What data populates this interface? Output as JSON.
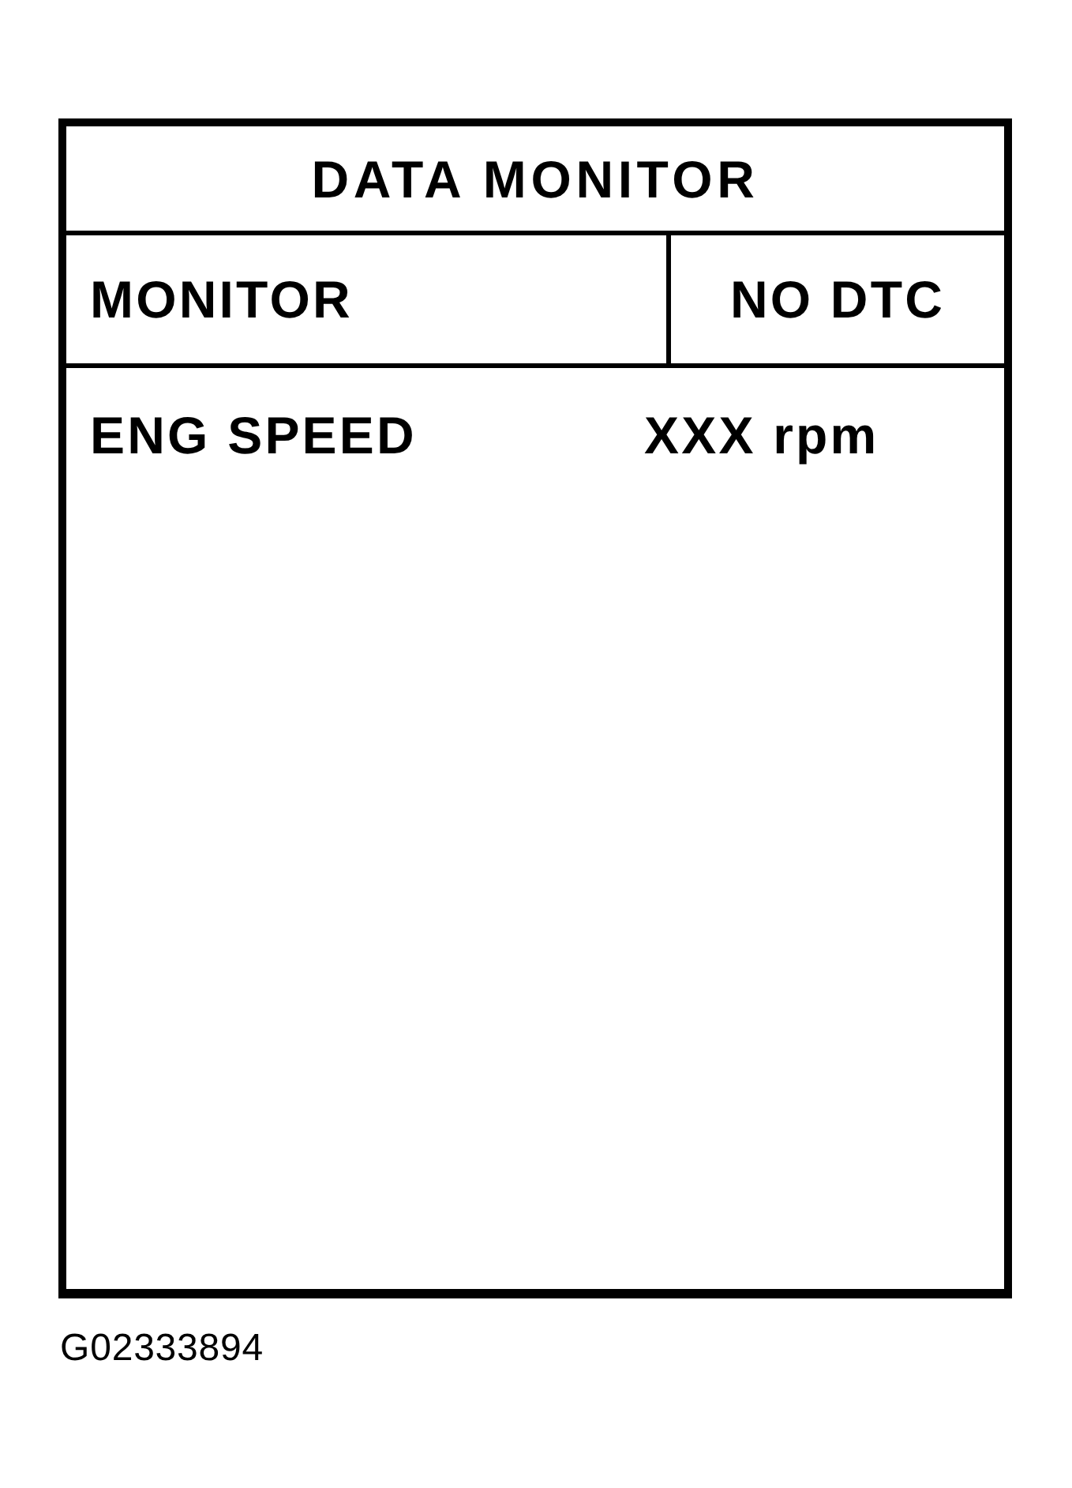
{
  "screen": {
    "title": "DATA MONITOR",
    "mode": "MONITOR",
    "dtc_status": "NO DTC",
    "parameters": [
      {
        "name": "ENG SPEED",
        "value": "XXX rpm"
      }
    ]
  },
  "figure_code": "G02333894"
}
